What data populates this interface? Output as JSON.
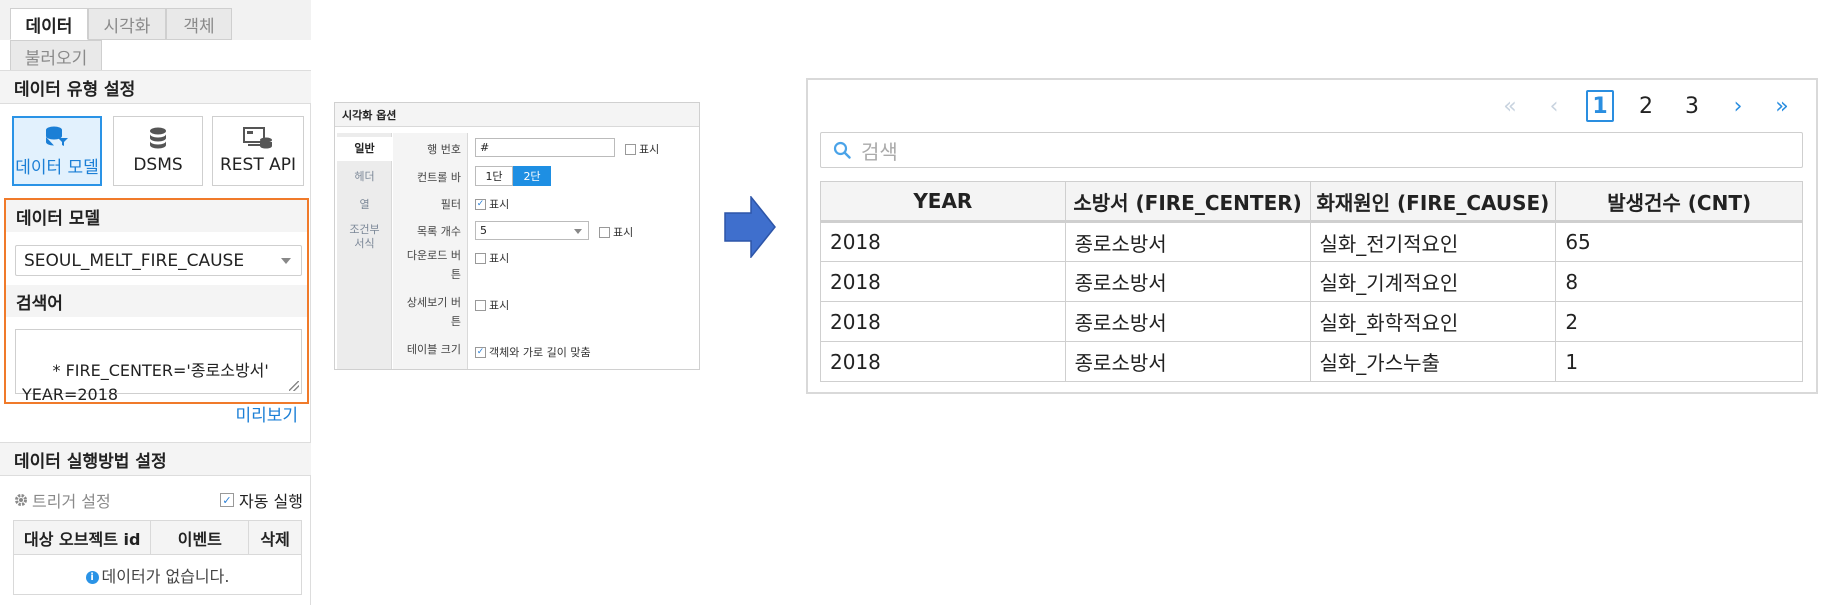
{
  "left": {
    "tabs": [
      "데이터",
      "시각화",
      "객체"
    ],
    "tab_row2": "불러오기",
    "data_type_header": "데이터 유형 설정",
    "type_options": [
      "데이터 모델",
      "DSMS",
      "REST API"
    ],
    "model_header": "데이터 모델",
    "model_value": "SEOUL_MELT_FIRE_CAUSE",
    "search_header": "검색어",
    "search_text": "* FIRE_CENTER='종로소방서'\nYEAR=2018",
    "preview_link": "미리보기",
    "exec_header": "데이터 실행방법 설정",
    "trigger_label": "트리거 설정",
    "auto_run_label": "자동 실행",
    "trigger_table": {
      "headers": [
        "대상 오브젝트 id",
        "이벤트",
        "삭제"
      ],
      "empty_text": "데이터가 없습니다."
    }
  },
  "mid": {
    "title": "시각화 옵션",
    "tabs": [
      "일반",
      "헤더",
      "열",
      "조건부\n서식"
    ],
    "labels": [
      "행 번호",
      "컨트롤 바",
      "필터",
      "목록 개수",
      "다운로드 버\n튼",
      "상세보기 버\n튼",
      "테이블 크기"
    ],
    "row_number_value": "#",
    "show_label": "표시",
    "segments": [
      "1단",
      "2단"
    ],
    "list_count_value": "5",
    "table_size_label": "객체와 가로 길이 맞춤"
  },
  "right": {
    "pages": [
      "1",
      "2",
      "3"
    ],
    "search_placeholder": "검색",
    "table": {
      "headers": [
        "YEAR",
        "소방서 (FIRE_CENTER)",
        "화재원인 (FIRE_CAUSE)",
        "발생건수 (CNT)"
      ],
      "rows": [
        [
          "2018",
          "종로소방서",
          "실화_전기적요인",
          "65"
        ],
        [
          "2018",
          "종로소방서",
          "실화_기계적요인",
          "8"
        ],
        [
          "2018",
          "종로소방서",
          "실화_화학적요인",
          "2"
        ],
        [
          "2018",
          "종로소방서",
          "실화_가스누출",
          "1"
        ]
      ]
    }
  },
  "colors": {
    "accent": "#2a93e6",
    "highlight_border": "#f07a2a",
    "arrow": "#3f6fcd"
  },
  "icons": {
    "data_model": "database-filter-icon",
    "dsms": "database-icon",
    "rest_api": "api-icon",
    "trigger": "gear-icon",
    "info": "info-icon",
    "search": "search-icon",
    "arrow": "right-arrow-icon"
  }
}
